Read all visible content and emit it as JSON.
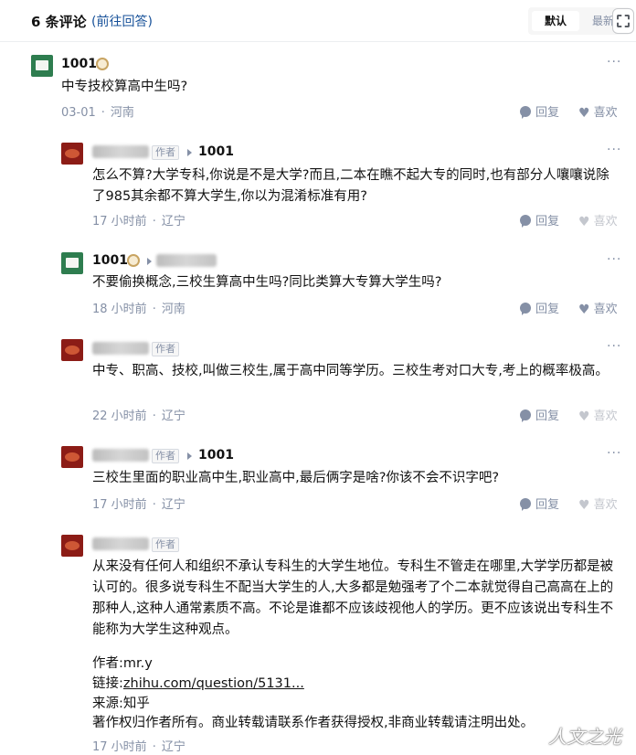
{
  "header": {
    "count_label": "6 条评论",
    "goto_label": "(前往回答)",
    "sort_default": "默认",
    "sort_latest": "最新"
  },
  "actions": {
    "reply": "回复",
    "like": "喜欢"
  },
  "comments": [
    {
      "author": "1001",
      "text": "中专技校算高中生吗?",
      "date": "03-01",
      "location": "河南"
    },
    {
      "author_tag": "作者",
      "reply_to": "1001",
      "text": "怎么不算?大学专科,你说是不是大学?而且,二本在瞧不起大专的同时,也有部分人嚷嚷说除了985其余都不算大学生,你以为混淆标准有用?",
      "date": "17 小时前",
      "location": "辽宁"
    },
    {
      "author": "1001",
      "text": "不要偷换概念,三校生算高中生吗?同比类算大专算大学生吗?",
      "date": "18 小时前",
      "location": "河南"
    },
    {
      "author_tag": "作者",
      "text": "中专、职高、技校,叫做三校生,属于高中同等学历。三校生考对口大专,考上的概率极高。",
      "date": "22 小时前",
      "location": "辽宁"
    },
    {
      "author_tag": "作者",
      "reply_to": "1001",
      "text": "三校生里面的职业高中生,职业高中,最后俩字是啥?你该不会不识字吧?",
      "date": "17 小时前",
      "location": "辽宁"
    },
    {
      "author_tag": "作者",
      "text": "从来没有任何人和组织不承认专科生的大学生地位。专科生不管走在哪里,大学学历都是被认可的。很多说专科生不配当大学生的人,大多都是勉强考了个二本就觉得自己高高在上的那种人,这种人通常素质不高。不论是谁都不应该歧视他人的学历。更不应该说出专科生不能称为大学生这种观点。",
      "source_author": "作者:mr.y",
      "source_link_label": "链接:",
      "source_link": "zhihu.com/question/5131...",
      "source_site": "来源:知乎",
      "copyright": "著作权归作者所有。商业转载请联系作者获得授权,非商业转载请注明出处。",
      "date": "17 小时前",
      "location": "辽宁"
    }
  ],
  "watermark": "人文之光",
  "icons": {
    "badge": "gold-badge-icon",
    "reply": "comment-bubble-icon",
    "like": "heart-icon",
    "more": "more-dots-icon",
    "fullscreen": "fullscreen-icon"
  },
  "colors": {
    "link": "#175199",
    "muted": "#8590a6",
    "text": "#121212"
  }
}
